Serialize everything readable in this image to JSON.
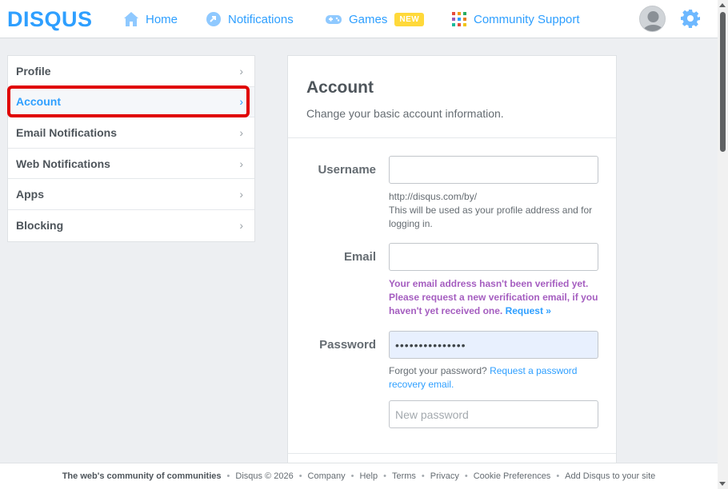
{
  "brand": {
    "logo_text": "DISQUS",
    "accent": "#2e9fff"
  },
  "nav": {
    "home": {
      "label": "Home",
      "icon": "home-icon"
    },
    "notifications": {
      "label": "Notifications",
      "icon": "notifications-icon"
    },
    "games": {
      "label": "Games",
      "icon": "gamepad-icon",
      "badge": "NEW"
    },
    "community": {
      "label": "Community Support",
      "icon": "community-grid-icon"
    }
  },
  "sidebar": {
    "items": [
      {
        "label": "Profile",
        "active": false
      },
      {
        "label": "Account",
        "active": true
      },
      {
        "label": "Email Notifications",
        "active": false
      },
      {
        "label": "Web Notifications",
        "active": false
      },
      {
        "label": "Apps",
        "active": false
      },
      {
        "label": "Blocking",
        "active": false
      }
    ]
  },
  "account": {
    "title": "Account",
    "subtitle": "Change your basic account information.",
    "username": {
      "label": "Username",
      "value": "",
      "help_url": "http://disqus.com/by/",
      "help_text": "This will be used as your profile address and for logging in."
    },
    "email": {
      "label": "Email",
      "value": "",
      "warning": "Your email address hasn't been verified yet. Please request a new verification email, if you haven't yet received one.",
      "request_link": "Request »"
    },
    "password": {
      "label": "Password",
      "value": "•••••••••••••••",
      "forgot_text": "Forgot your password?",
      "recovery_link": "Request a password recovery email.",
      "new_placeholder": "New password"
    }
  },
  "footer": {
    "tagline": "The web's community of communities",
    "copyright": "Disqus © 2026",
    "links": [
      "Company",
      "Help",
      "Terms",
      "Privacy",
      "Cookie Preferences",
      "Add Disqus to your site"
    ]
  }
}
